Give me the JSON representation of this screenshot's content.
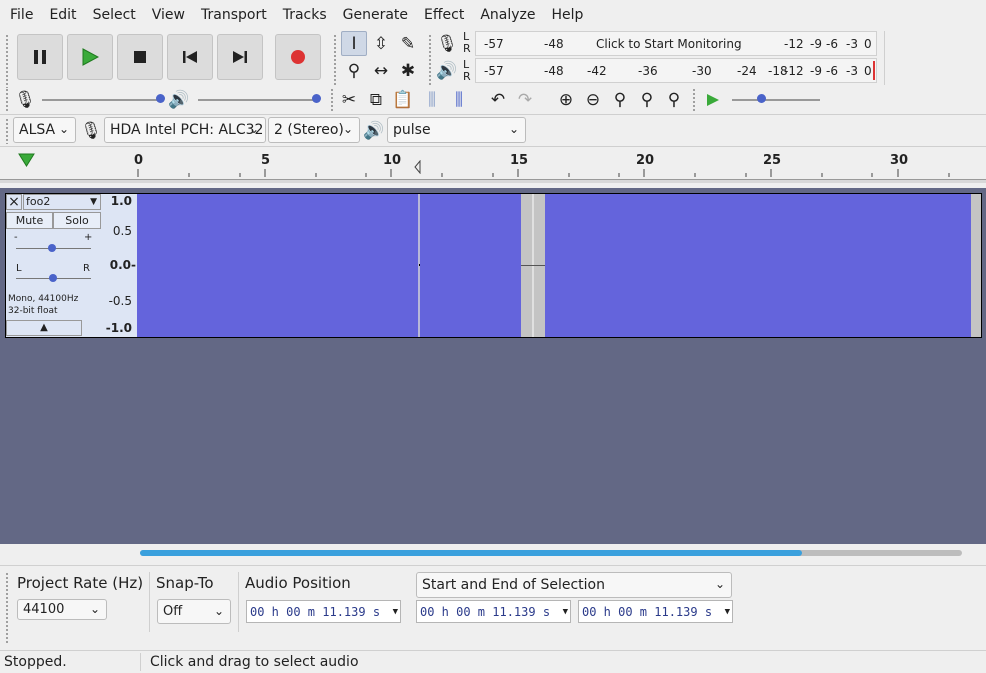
{
  "menu": [
    "File",
    "Edit",
    "Select",
    "View",
    "Transport",
    "Tracks",
    "Generate",
    "Effect",
    "Analyze",
    "Help"
  ],
  "meters": {
    "record_scale": [
      "-57",
      "-48",
      "-12",
      "-9",
      "-6",
      "-3",
      "0"
    ],
    "record_prompt": "Click to Start Monitoring",
    "play_scale": [
      "-57",
      "-48",
      "-42",
      "-36",
      "-30",
      "-24",
      "-18",
      "-12",
      "-9",
      "-6",
      "-3",
      "0"
    ],
    "left": "L",
    "right": "R"
  },
  "device": {
    "host": "ALSA",
    "input": "HDA Intel PCH: ALC32",
    "channels": "2 (Stereo)",
    "output": "pulse"
  },
  "ruler": {
    "ticks": [
      "0",
      "5",
      "10",
      "15",
      "20",
      "25",
      "30"
    ]
  },
  "track": {
    "name": "foo2",
    "close": "×",
    "mute": "Mute",
    "solo": "Solo",
    "gain_min": "-",
    "gain_max": "+",
    "pan_left": "L",
    "pan_right": "R",
    "info_line1": "Mono, 44100Hz",
    "info_line2": "32-bit float",
    "scale": [
      "1.0",
      "0.5",
      "0.0-",
      "-0.5",
      "-1.0"
    ]
  },
  "selection_bar": {
    "rate_label": "Project Rate (Hz)",
    "rate_value": "44100",
    "snap_label": "Snap-To",
    "snap_value": "Off",
    "position_label": "Audio Position",
    "selection_mode": "Start and End of Selection",
    "audio_position": "00 h 00 m 11.139 s",
    "selection_start": "00 h 00 m 11.139 s",
    "selection_end": "00 h 00 m 11.139 s"
  },
  "status": {
    "state": "Stopped.",
    "hint": "Click and drag to select audio"
  },
  "colors": {
    "waveform": "#6464dc",
    "track_background": "#636885",
    "record_button": "#dd3333",
    "play_button": "#33aa33",
    "scroll_thumb": "#3aa0dd"
  }
}
